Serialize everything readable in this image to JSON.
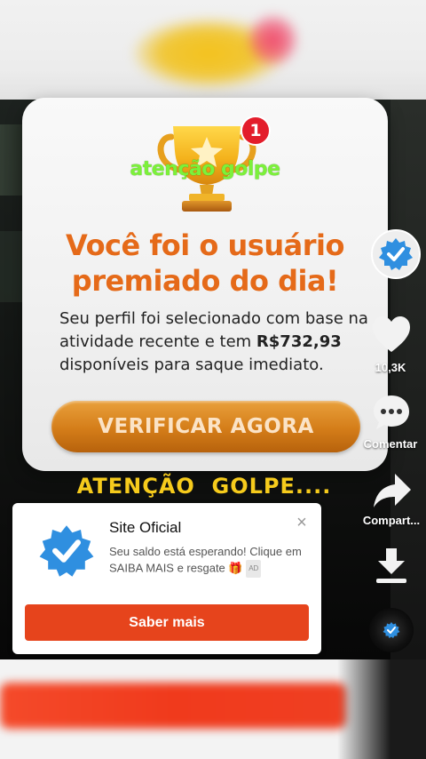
{
  "prize_popup": {
    "notification_count": "1",
    "watermark": "atenção golpe",
    "title": "Você foi o usuário premiado do dia!",
    "description_prefix": "Seu perfil foi selecionado com base na atividade recente e tem ",
    "amount": "R$732,93",
    "description_suffix": " disponíveis para saque imediato.",
    "button_label": "VERIFICAR AGORA"
  },
  "subtitle": "ATENÇÃO  GOLPE....",
  "action_rail": {
    "likes": "10,3K",
    "comment_label": "Comentar",
    "share_label": "Compart..."
  },
  "ad": {
    "title": "Site Oficial",
    "text": "Seu saldo está esperando! Clique em SAIBA MAIS e resgate 🎁",
    "tag": "AD",
    "close": "×",
    "cta_label": "Saber mais"
  },
  "colors": {
    "title_orange": "#e56a19",
    "button_orange": "#d47d19",
    "subtitle_yellow": "#f6cb1c",
    "watermark_green": "#7cf13a",
    "ad_cta_red": "#e6441c",
    "verified_blue": "#2f8fe0"
  }
}
